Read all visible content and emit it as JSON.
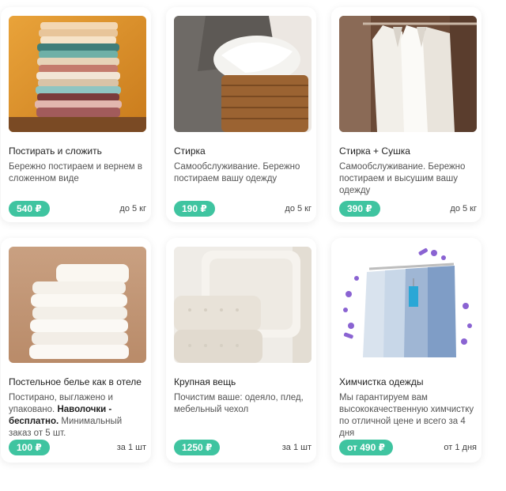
{
  "services": [
    {
      "image_icon": "folded-clothes-stack",
      "title": "Постирать и сложить",
      "description": "Бережно постираем и вернем в сложенном виде",
      "price": "540 ₽",
      "unit": "до 5 кг"
    },
    {
      "image_icon": "laundry-basket",
      "title": "Стирка",
      "description": "Самообслуживание. Бережно постираем вашу одежду",
      "price": "190 ₽",
      "unit": "до 5 кг"
    },
    {
      "image_icon": "shirts-on-hangers",
      "title": "Стирка + Сушка",
      "description": "Самообслуживание. Бережно постираем и высушим вашу одежду",
      "price": "390 ₽",
      "unit": "до 5 кг"
    },
    {
      "image_icon": "folded-bed-linen",
      "title": "Постельное белье как в отеле",
      "description_part1": "Постирано, выглажено и упаковано. ",
      "description_bold": "Наволочки - бесплатно.",
      "description_part2": " Минимальный заказ от 5 шт.",
      "price": "100 ₽",
      "unit": "за 1 шт"
    },
    {
      "image_icon": "pillow-and-blankets",
      "title": "Крупная вещь",
      "description": "Почистим ваше: одеяло, плед, мебельный чехол",
      "price": "1250 ₽",
      "unit": "за 1 шт"
    },
    {
      "image_icon": "garments-in-covers",
      "title": "Химчистка одежды",
      "description": "Мы гарантируем вам высококачественную химчистку по отличной цене и всего за 4 дня",
      "price": "от 490 ₽",
      "unit": "от 1 дня"
    }
  ],
  "colors": {
    "price_badge": "#3fc4a0",
    "accent_purple": "#8a63d2"
  }
}
